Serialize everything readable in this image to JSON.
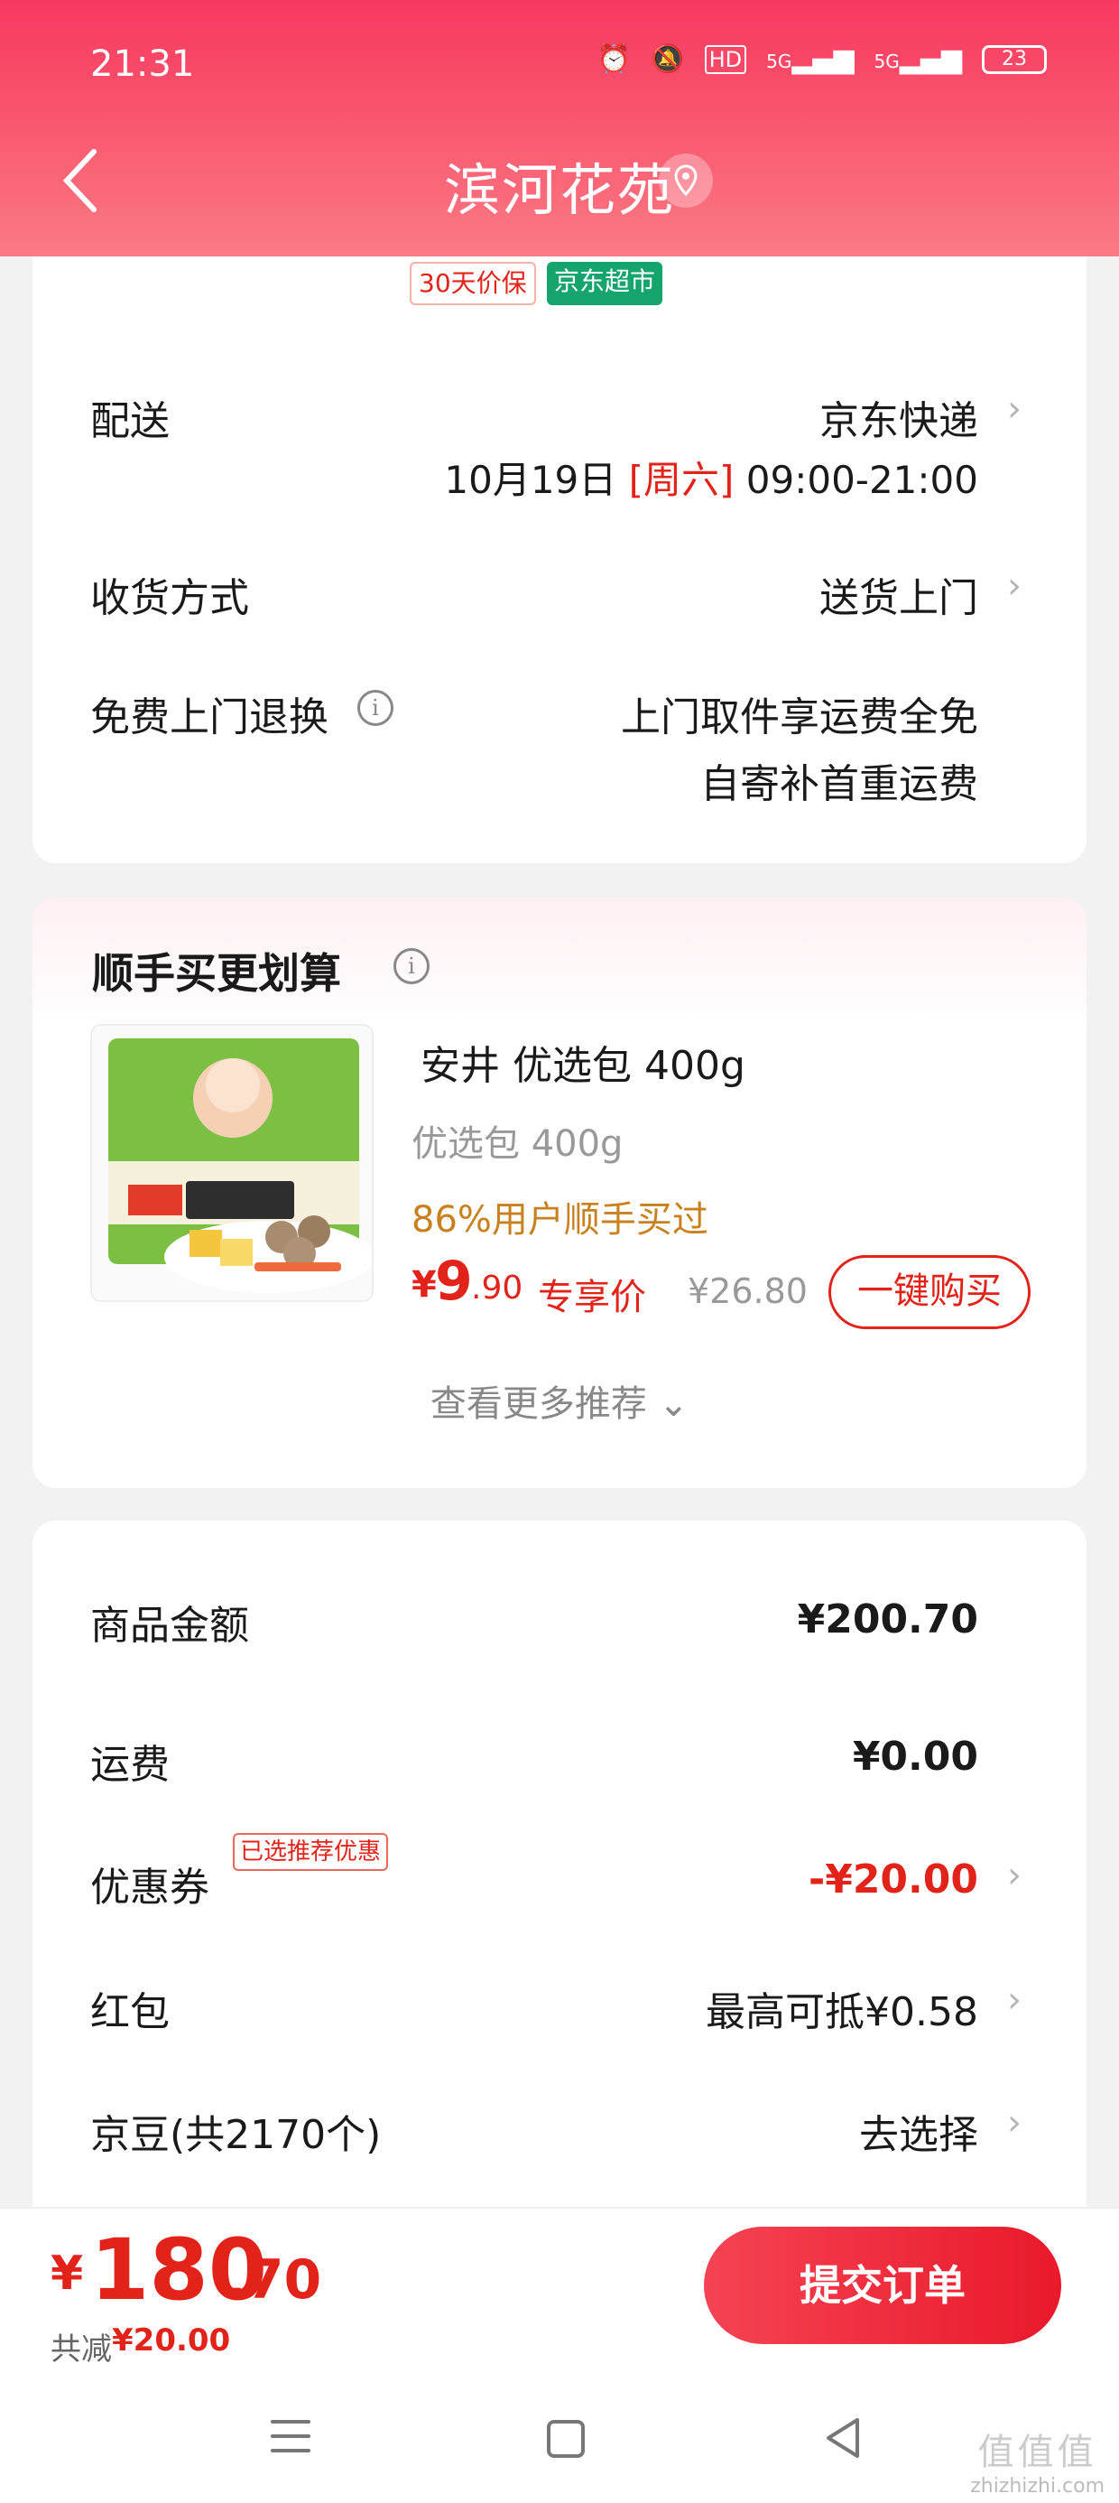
{
  "status": {
    "time": "21:31",
    "hd": "HD",
    "net1": "5G",
    "net2": "5G",
    "battery": "23"
  },
  "header": {
    "title": "滨河花苑"
  },
  "tags": {
    "price_protect": "30天价保",
    "market": "京东超市"
  },
  "delivery": {
    "label": "配送",
    "carrier": "京东快递",
    "date": "10月19日",
    "weekday": "[周六]",
    "time": "09:00-21:00"
  },
  "receive": {
    "label": "收货方式",
    "value": "送货上门"
  },
  "returns": {
    "label": "免费上门退换",
    "line1": "上门取件享运费全免",
    "line2": "自寄补首重运费"
  },
  "addon": {
    "title": "顺手买更划算",
    "product_name": "安井 优选包 400g",
    "spec": "优选包 400g",
    "social": "86%用户顺手买过",
    "price_symbol": "¥",
    "price_int": "9",
    "price_dec": ".90",
    "price_tag": "专享价",
    "orig_price": "¥26.80",
    "buy_label": "一键购买",
    "see_more": "查看更多推荐"
  },
  "summary": {
    "goods_label": "商品金额",
    "goods_value": "¥200.70",
    "freight_label": "运费",
    "freight_value": "¥0.00",
    "coupon_label": "优惠券",
    "coupon_badge": "已选推荐优惠",
    "coupon_value": "-¥20.00",
    "redpacket_label": "红包",
    "redpacket_value": "最高可抵¥0.58",
    "bean_label": "京豆(共2170个)",
    "bean_value": "去选择"
  },
  "footer": {
    "total_symbol": "¥",
    "total_int": "180",
    "total_dec": ".70",
    "discount_label": "共减",
    "discount_value": "¥20.00",
    "submit_label": "提交订单"
  },
  "watermark": {
    "main": "值值值",
    "sub": "zhizhizhi.com"
  },
  "colors": {
    "brand_red": "#e2231a",
    "header_gradient_start": "#f7385e",
    "market_green": "#15a36e",
    "social_orange": "#c8811f"
  }
}
